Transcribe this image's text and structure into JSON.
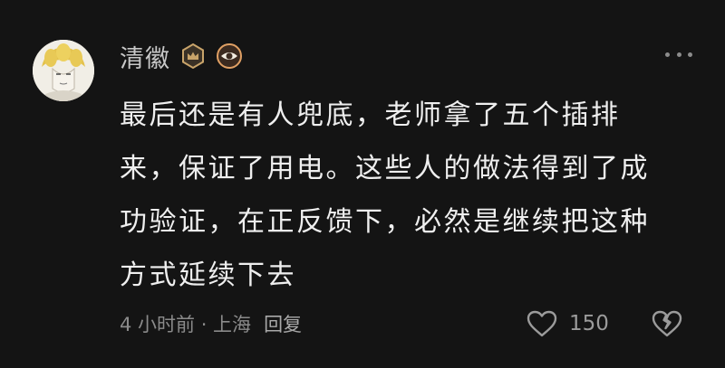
{
  "comment": {
    "username": "清徽",
    "badges": [
      "crown-badge-icon",
      "eye-badge-icon"
    ],
    "more_icon": "more-dots-icon",
    "text": "最后还是有人兜底，老师拿了五个插排\n来，保证了用电。这些人的做法得到了成\n功验证，在正反馈下，必然是继续把这种\n方式延续下去",
    "meta": "4 小时前 · 上海",
    "reply_label": "回复",
    "like_icon": "heart-icon",
    "like_count": "150",
    "dislike_icon": "broken-heart-icon"
  },
  "colors": {
    "background": "#141414",
    "text": "#efefef",
    "muted": "#8a8a8a",
    "badge_gold": "#c9a46a"
  }
}
